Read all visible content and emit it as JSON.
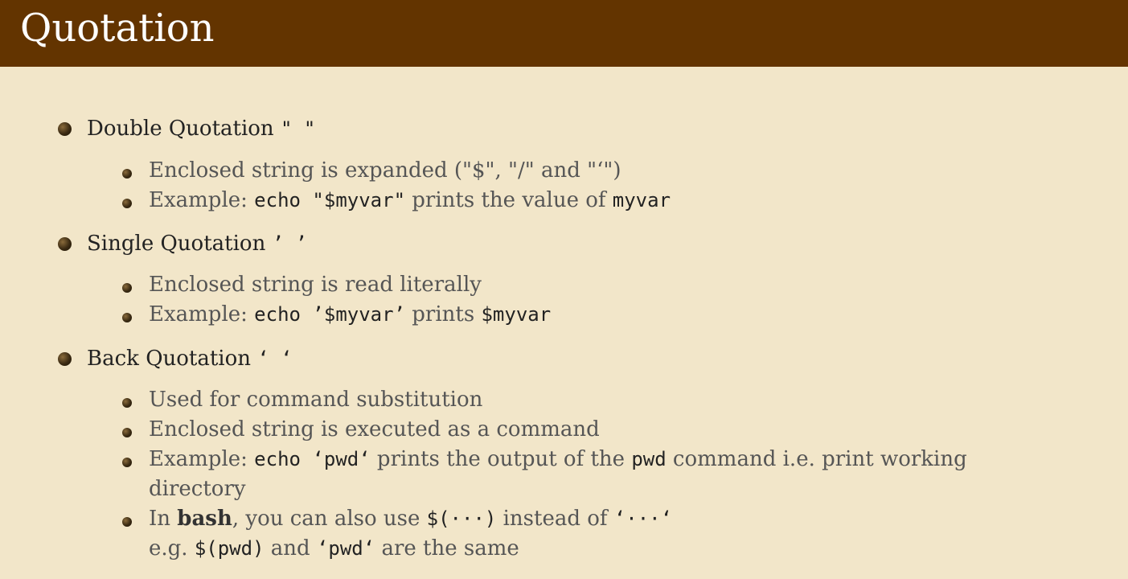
{
  "slide": {
    "title": "Quotation",
    "sections": [
      {
        "label": "Double Quotation",
        "symbol": "\" \"",
        "items": [
          {
            "prefix": "Enclosed string is expanded (",
            "quote1": "\"$\"",
            "sep1": ", ",
            "quote2": "\"/\"",
            "sep2": " and ",
            "quote3": "\"‘\"",
            "suffix": ")"
          },
          {
            "prefix": "Example: ",
            "code1": "echo \"$myvar\"",
            "middle": " prints the value of ",
            "code2": "myvar"
          }
        ]
      },
      {
        "label": "Single Quotation",
        "symbol": "’ ’",
        "items": [
          {
            "text": "Enclosed string is read literally"
          },
          {
            "prefix": "Example: ",
            "code1": "echo ’$myvar’",
            "middle": " prints ",
            "code2": "$myvar"
          }
        ]
      },
      {
        "label": "Back Quotation",
        "symbol": "‘ ‘",
        "items": [
          {
            "text": "Used for command substitution"
          },
          {
            "text": "Enclosed string is executed as a command"
          },
          {
            "prefix": "Example: ",
            "code1": "echo ‘pwd‘",
            "middle": " prints the output of the ",
            "code2": "pwd",
            "suffix": " command i.e. print working",
            "continuation": "directory"
          },
          {
            "prefix": "In ",
            "bold": "bash",
            "middle1": ", you can also use ",
            "code1": "$(···)",
            "middle2": " instead of ",
            "code2": "‘···‘",
            "line2_prefix": "e.g. ",
            "line2_code1": "$(pwd)",
            "line2_middle": " and ",
            "line2_code2": "‘pwd‘",
            "line2_suffix": " are the same"
          }
        ]
      }
    ]
  },
  "colors": {
    "title_bar": "#633400",
    "background": "#f2e6c9",
    "title_text": "#ffffff",
    "main_text": "#222222",
    "sub_text": "#555555"
  }
}
